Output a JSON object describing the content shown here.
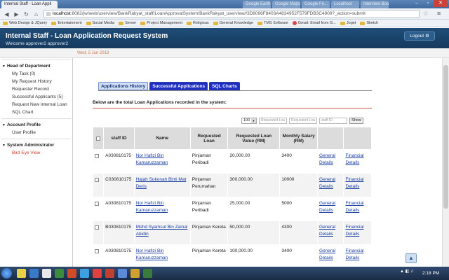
{
  "browser": {
    "tabs": [
      {
        "title": "Internal Staff - Loan Appli",
        "active": true
      },
      {
        "title": "Google Earth",
        "active": false
      },
      {
        "title": "Google Maps",
        "active": false
      },
      {
        "title": "Google Fri...",
        "active": false
      },
      {
        "title": "Localhost",
        "active": false
      },
      {
        "title": "Interview Bookin",
        "active": false
      }
    ],
    "url_host": "localhost",
    "url_rest": ":8082/jw/web/userview/BankRakyat_staff/LoanApprovalSystem/BankRakyat_userview//3D8096F8403A4834952F579FDB3C4900?_action=submit",
    "bookmarks": [
      "Web Design & JQuery",
      "Entertainment",
      "Social Media",
      "Server",
      "Project Management",
      "Religious",
      "General Knowledge",
      "TMS Software",
      "Gmail: Email from G...",
      "Joget",
      "Sketch"
    ]
  },
  "header": {
    "title": "Internal Staff - Loan Application Request System",
    "welcome": "Welcome approver2 approver2",
    "logout": "Logout"
  },
  "date": "Wed, 5 Jun 2013",
  "sidebar": {
    "sections": [
      {
        "title": "Head of Department",
        "items": [
          {
            "label": "My Task (0)"
          },
          {
            "label": "My Request History"
          },
          {
            "label": "Requester Record"
          },
          {
            "label": "Successful Applicants (5)"
          },
          {
            "label": "Request New Internal Loan"
          },
          {
            "label": "SQL Chart"
          }
        ]
      },
      {
        "title": "Account Profile",
        "items": [
          {
            "label": "User Profile"
          }
        ]
      },
      {
        "title": "System Administrator",
        "items": [
          {
            "label": "Bird Eye View"
          }
        ]
      }
    ]
  },
  "main": {
    "tabs": [
      "Applications History",
      "Successful Applications",
      "SQL Charts"
    ],
    "intro": "Below are the total Loan Applications recorded in the system:",
    "filters": {
      "page_size": "100",
      "requested_loan_placeholder": "Requested Loa",
      "requested_loan2_placeholder": "Requested Loa",
      "staff_id_placeholder": "staff ID",
      "show": "Show"
    },
    "columns": [
      "staff ID",
      "Name",
      "Requested Loan",
      "Requested Loan Value (RM)",
      "Monthly Salary (RM)",
      "",
      ""
    ],
    "rows": [
      {
        "staff_id": "A030810175",
        "name": "Nor Hafizi Bin Kamaruzzaman",
        "loan": "Pinjaman Peribadi",
        "value": "20,000.00",
        "salary": "3400",
        "general": "General Details",
        "financial": "Financial Details"
      },
      {
        "staff_id": "C030810175",
        "name": "Hajah Sukonah Binti Mat Deris",
        "loan": "Pinjaman Perumahan",
        "value": "300,000.00",
        "salary": "10000",
        "general": "General Details",
        "financial": "Financial Details"
      },
      {
        "staff_id": "A030810175",
        "name": "Nor Hafizi Bin Kamaruzzaman",
        "loan": "Pinjaman Peribadi",
        "value": "25,000.00",
        "salary": "5000",
        "general": "General Details",
        "financial": "Financial Details"
      },
      {
        "staff_id": "B030810175",
        "name": "Mohd Syamsul Bin Zainal Abidin",
        "loan": "Pinjaman Kereta",
        "value": "50,000.00",
        "salary": "4300",
        "general": "General Details",
        "financial": "Financial Details"
      },
      {
        "staff_id": "A030810175",
        "name": "Nor Hafizi Bin Kamaruzzaman",
        "loan": "Pinjaman Kereta",
        "value": "100,000.00",
        "salary": "3400",
        "general": "General Details",
        "financial": "Financial Details"
      }
    ]
  },
  "taskbar": {
    "clock": "2:18 PM",
    "colors": [
      "#e8d24a",
      "#3a78c8",
      "#e8e8e8",
      "#3c8b3c",
      "#d04a2a",
      "#3fa0e0",
      "#e04040",
      "#c04030",
      "#5a8ad8",
      "#d0a030",
      "#3a7a3a"
    ]
  }
}
